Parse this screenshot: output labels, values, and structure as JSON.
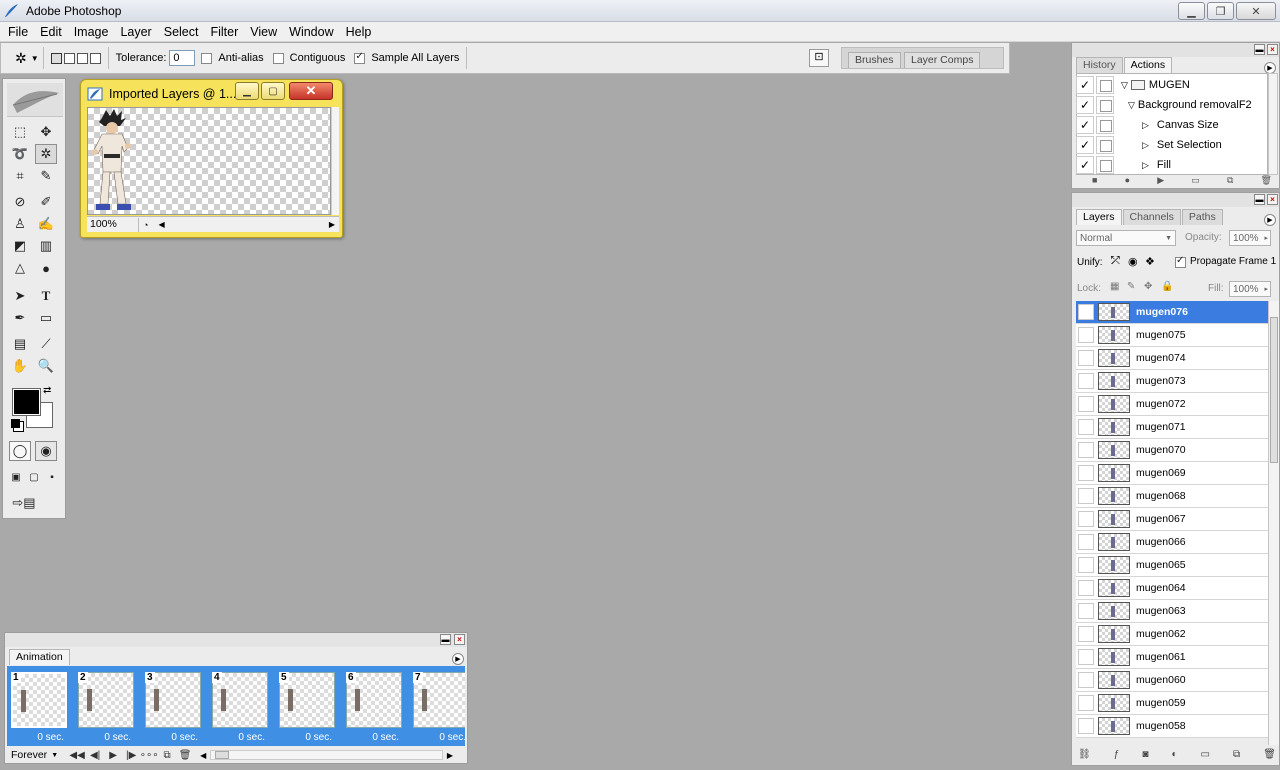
{
  "window": {
    "title": "Adobe Photoshop"
  },
  "menu": [
    "File",
    "Edit",
    "Image",
    "Layer",
    "Select",
    "Filter",
    "View",
    "Window",
    "Help"
  ],
  "options": {
    "tolerance_label": "Tolerance:",
    "tolerance_value": "0",
    "anti_alias_label": "Anti-alias",
    "contiguous_label": "Contiguous",
    "sample_all_label": "Sample All Layers",
    "well_tabs": [
      "Brushes",
      "Layer Comps"
    ]
  },
  "document": {
    "title": "Imported Layers @ 1...",
    "zoom": "100%"
  },
  "actions_panel": {
    "tabs": [
      "History",
      "Actions"
    ],
    "rows": [
      {
        "label": "MUGEN",
        "level": 0
      },
      {
        "label": "Background removal",
        "shortcut": "F2",
        "level": 1
      },
      {
        "label": "Canvas Size",
        "level": 2
      },
      {
        "label": "Set Selection",
        "level": 2
      },
      {
        "label": "Fill",
        "level": 2
      }
    ]
  },
  "layers_panel": {
    "tabs": [
      "Layers",
      "Channels",
      "Paths"
    ],
    "blend_mode": "Normal",
    "opacity_label": "Opacity:",
    "opacity_value": "100%",
    "unify_label": "Unify:",
    "propagate_label": "Propagate Frame 1",
    "lock_label": "Lock:",
    "fill_label": "Fill:",
    "fill_value": "100%",
    "layers": [
      "mugen076",
      "mugen075",
      "mugen074",
      "mugen073",
      "mugen072",
      "mugen071",
      "mugen070",
      "mugen069",
      "mugen068",
      "mugen067",
      "mugen066",
      "mugen065",
      "mugen064",
      "mugen063",
      "mugen062",
      "mugen061",
      "mugen060",
      "mugen059",
      "mugen058"
    ]
  },
  "animation_panel": {
    "tab": "Animation",
    "frames": [
      {
        "num": "1",
        "delay": "0 sec."
      },
      {
        "num": "2",
        "delay": "0 sec."
      },
      {
        "num": "3",
        "delay": "0 sec."
      },
      {
        "num": "4",
        "delay": "0 sec."
      },
      {
        "num": "5",
        "delay": "0 sec."
      },
      {
        "num": "6",
        "delay": "0 sec."
      },
      {
        "num": "7",
        "delay": "0 sec."
      }
    ],
    "loop": "Forever"
  }
}
